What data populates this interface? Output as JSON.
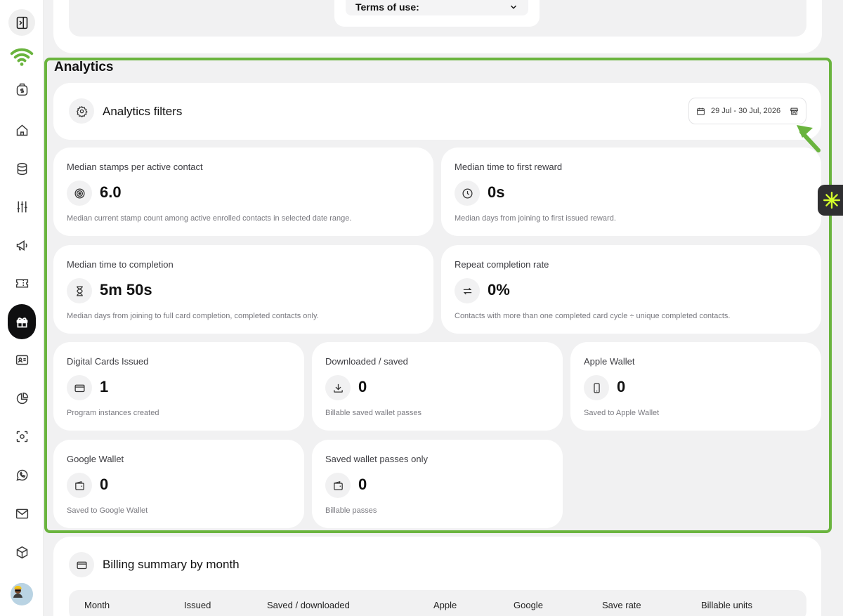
{
  "sidebar": {
    "items": [
      {
        "name": "sidebar-toggle",
        "icon": "panel-right-icon"
      },
      {
        "name": "brand-logo",
        "icon": "wifi-logo-icon"
      },
      {
        "name": "sidebar-item-money",
        "icon": "money-bag-icon"
      },
      {
        "name": "sidebar-item-home",
        "icon": "home-icon"
      },
      {
        "name": "sidebar-item-database",
        "icon": "database-icon"
      },
      {
        "name": "sidebar-item-adjustments",
        "icon": "sliders-icon"
      },
      {
        "name": "sidebar-item-campaigns",
        "icon": "megaphone-icon"
      },
      {
        "name": "sidebar-item-tickets",
        "icon": "ticket-icon"
      },
      {
        "name": "sidebar-item-rewards",
        "icon": "gift-icon",
        "active": true
      },
      {
        "name": "sidebar-item-contacts",
        "icon": "id-card-icon"
      },
      {
        "name": "sidebar-item-reports",
        "icon": "pie-chart-icon"
      },
      {
        "name": "sidebar-item-scan",
        "icon": "scan-icon"
      },
      {
        "name": "sidebar-item-whatsapp",
        "icon": "whatsapp-icon"
      },
      {
        "name": "sidebar-item-mail",
        "icon": "mail-icon"
      },
      {
        "name": "sidebar-item-products",
        "icon": "box-icon"
      },
      {
        "name": "sidebar-item-profile",
        "icon": "avatar-icon"
      }
    ]
  },
  "top": {
    "terms_label": "Terms of use:"
  },
  "analytics": {
    "title": "Analytics",
    "filters": {
      "title": "Analytics filters",
      "date_range": "29 Jul - 30 Jul, 2026"
    },
    "metrics": [
      {
        "label": "Median stamps per active contact",
        "value": "6.0",
        "desc": "Median current stamp count among active enrolled contacts in selected date range.",
        "icon": "target-icon"
      },
      {
        "label": "Median time to first reward",
        "value": "0s",
        "desc": "Median days from joining to first issued reward.",
        "icon": "clock-icon"
      },
      {
        "label": "Median time to completion",
        "value": "5m 50s",
        "desc": "Median days from joining to full card completion, completed contacts only.",
        "icon": "hourglass-icon"
      },
      {
        "label": "Repeat completion rate",
        "value": "0%",
        "desc": "Contacts with more than one completed card cycle ÷ unique completed contacts.",
        "icon": "repeat-icon"
      },
      {
        "label": "Digital Cards Issued",
        "value": "1",
        "desc": "Program instances created",
        "icon": "card-icon"
      },
      {
        "label": "Downloaded / saved",
        "value": "0",
        "desc": "Billable saved wallet passes",
        "icon": "download-icon"
      },
      {
        "label": "Apple Wallet",
        "value": "0",
        "desc": "Saved to Apple Wallet",
        "icon": "phone-icon"
      },
      {
        "label": "Google Wallet",
        "value": "0",
        "desc": "Saved to Google Wallet",
        "icon": "wallet-icon"
      },
      {
        "label": "Saved wallet passes only",
        "value": "0",
        "desc": "Billable passes",
        "icon": "wallet-icon"
      }
    ]
  },
  "billing": {
    "title": "Billing summary by month",
    "columns": [
      "Month",
      "Issued",
      "Saved / downloaded",
      "Apple",
      "Google",
      "Save rate",
      "Billable units"
    ]
  },
  "colors": {
    "accent_green": "#6ab43e",
    "active_nav": "#0f0f10",
    "help_tab_icon": "#d4ff2a"
  }
}
